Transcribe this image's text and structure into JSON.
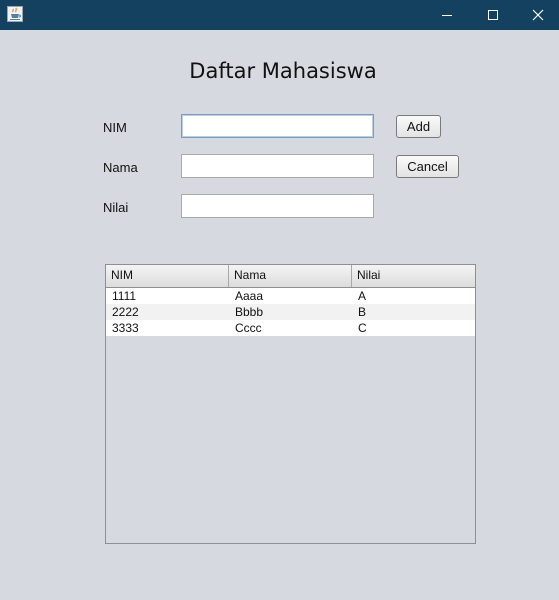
{
  "window": {
    "icon": "java-cup-icon",
    "controls": {
      "minimize_icon": "minimize-icon",
      "maximize_icon": "maximize-icon",
      "close_icon": "close-icon"
    }
  },
  "form": {
    "title": "Daftar Mahasiswa",
    "nim_label": "NIM",
    "nama_label": "Nama",
    "nilai_label": "Nilai",
    "nim_value": "",
    "nama_value": "",
    "nilai_value": "",
    "add_label": "Add",
    "cancel_label": "Cancel"
  },
  "table": {
    "columns": [
      "NIM",
      "Nama",
      "Nilai"
    ],
    "rows": [
      [
        "1111",
        "Aaaa",
        "A"
      ],
      [
        "2222",
        "Bbbb",
        "B"
      ],
      [
        "3333",
        "Cccc",
        "C"
      ]
    ]
  },
  "colors": {
    "titlebar": "#144160",
    "background": "#d6d9df",
    "table_row_odd": "#ffffff",
    "table_row_even": "#f2f2f2"
  }
}
